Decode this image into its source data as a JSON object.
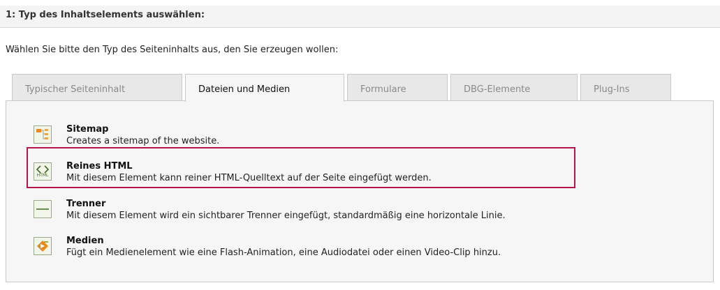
{
  "header": {
    "title": "1: Typ des Inhaltselements auswählen:"
  },
  "intro_text": "Wählen Sie bitte den Typ des Seiteninhalts aus, den Sie erzeugen wollen:",
  "tabs": [
    {
      "label": "Typischer Seiteninhalt",
      "active": false
    },
    {
      "label": "Dateien und Medien",
      "active": true
    },
    {
      "label": "Formulare",
      "active": false
    },
    {
      "label": "DBG-Elemente",
      "active": false
    },
    {
      "label": "Plug-Ins",
      "active": false
    }
  ],
  "items": [
    {
      "icon": "sitemap-icon",
      "title": "Sitemap",
      "description": "Creates a sitemap of the website."
    },
    {
      "icon": "html-code-icon",
      "icon_text": "HTML",
      "title": "Reines HTML",
      "description": "Mit diesem Element kann reiner HTML-Quelltext auf der Seite eingefügt werden.",
      "highlighted": true
    },
    {
      "icon": "divider-icon",
      "title": "Trenner",
      "description": "Mit diesem Element wird ein sichtbarer Trenner eingefügt, standardmäßig eine horizontale Linie."
    },
    {
      "icon": "media-icon",
      "title": "Medien",
      "description": "Fügt ein Medienelement wie eine Flash-Animation, eine Audiodatei oder einen Video-Clip hinzu."
    }
  ],
  "colors": {
    "highlight": "#b5164a",
    "icon_green": "#6a9a2a",
    "icon_orange": "#e88a1a"
  }
}
